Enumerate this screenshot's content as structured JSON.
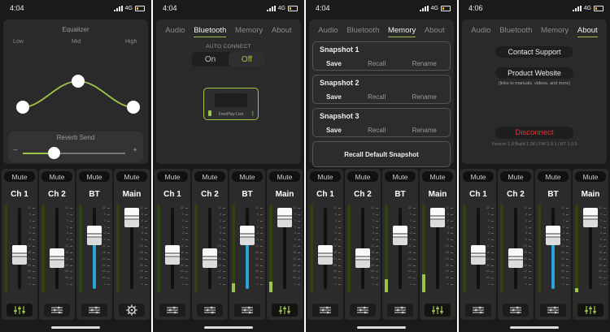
{
  "tab_labels": [
    "Audio",
    "Bluetooth",
    "Memory",
    "About"
  ],
  "screens": [
    {
      "time": "4:04",
      "network": "4G",
      "active_tab": null,
      "equalizer": {
        "title": "Equalizer",
        "low": "Low",
        "mid": "Mid",
        "high": "High",
        "curve": "bell"
      },
      "reverb": {
        "title": "Reverb Send",
        "minus": "−",
        "plus": "+",
        "level": 0.3
      },
      "channels": [
        {
          "mute": "Mute",
          "name": "Ch 1",
          "fader": 0.6,
          "meter": 0.0,
          "icon": "mixer-sliders-icon",
          "icon_active": true,
          "blue": 0
        },
        {
          "mute": "Mute",
          "name": "Ch 2",
          "fader": 0.65,
          "meter": 0.0,
          "icon": "sliders-icon",
          "icon_active": false,
          "blue": 0
        },
        {
          "mute": "Mute",
          "name": "BT",
          "fader": 0.3,
          "meter": 0.0,
          "icon": "sliders-icon",
          "icon_active": false,
          "blue": 0.55
        },
        {
          "mute": "Mute",
          "name": "Main",
          "fader": 0.03,
          "meter": 0.0,
          "icon": "gear-icon",
          "icon_active": false,
          "blue": 0
        }
      ]
    },
    {
      "time": "4:04",
      "network": "4G",
      "active_tab": "Bluetooth",
      "auto_connect": {
        "title": "AUTO CONNECT",
        "on": "On",
        "off": "Off",
        "selected": "Off"
      },
      "device": {
        "name": "FreePlay Live",
        "icon": "bluetooth-icon"
      },
      "channels": [
        {
          "mute": "Mute",
          "name": "Ch 1",
          "fader": 0.6,
          "meter": 0.0,
          "icon": "sliders-icon",
          "icon_active": false,
          "blue": 0
        },
        {
          "mute": "Mute",
          "name": "Ch 2",
          "fader": 0.65,
          "meter": 0.0,
          "icon": "sliders-icon",
          "icon_active": false,
          "blue": 0
        },
        {
          "mute": "Mute",
          "name": "BT",
          "fader": 0.3,
          "meter": 0.1,
          "icon": "sliders-icon",
          "icon_active": false,
          "blue": 0.55
        },
        {
          "mute": "Mute",
          "name": "Main",
          "fader": 0.03,
          "meter": 0.12,
          "icon": "mixer-sliders-icon",
          "icon_active": true,
          "blue": 0
        }
      ]
    },
    {
      "time": "4:04",
      "network": "4G",
      "active_tab": "Memory",
      "snapshots": [
        {
          "name": "Snapshot 1",
          "save": "Save",
          "recall": "Recall",
          "rename": "Rename"
        },
        {
          "name": "Snapshot 2",
          "save": "Save",
          "recall": "Recall",
          "rename": "Rename"
        },
        {
          "name": "Snapshot 3",
          "save": "Save",
          "recall": "Recall",
          "rename": "Rename"
        }
      ],
      "recall_default": "Recall Default Snapshot",
      "channels": [
        {
          "mute": "Mute",
          "name": "Ch 1",
          "fader": 0.6,
          "meter": 0.0,
          "icon": "sliders-icon",
          "icon_active": false,
          "blue": 0
        },
        {
          "mute": "Mute",
          "name": "Ch 2",
          "fader": 0.65,
          "meter": 0.0,
          "icon": "sliders-icon",
          "icon_active": false,
          "blue": 0
        },
        {
          "mute": "Mute",
          "name": "BT",
          "fader": 0.3,
          "meter": 0.15,
          "icon": "sliders-icon",
          "icon_active": false,
          "blue": 0
        },
        {
          "mute": "Mute",
          "name": "Main",
          "fader": 0.03,
          "meter": 0.2,
          "icon": "mixer-sliders-icon",
          "icon_active": true,
          "blue": 0
        }
      ]
    },
    {
      "time": "4:06",
      "network": "4G",
      "active_tab": "About",
      "contact": "Contact Support",
      "website": "Product Website",
      "links_note": "(links to manuals, videos, and more)",
      "disconnect": "Disconnect",
      "version": "Version 1.0 Build 1.28 | FW 1.0.1 | BT 1.0.5",
      "channels": [
        {
          "mute": "Mute",
          "name": "Ch 1",
          "fader": 0.6,
          "meter": 0.0,
          "icon": "sliders-icon",
          "icon_active": false,
          "blue": 0
        },
        {
          "mute": "Mute",
          "name": "Ch 2",
          "fader": 0.65,
          "meter": 0.0,
          "icon": "sliders-icon",
          "icon_active": false,
          "blue": 0
        },
        {
          "mute": "Mute",
          "name": "BT",
          "fader": 0.3,
          "meter": 0.0,
          "icon": "sliders-icon",
          "icon_active": false,
          "blue": 0.55
        },
        {
          "mute": "Mute",
          "name": "Main",
          "fader": 0.03,
          "meter": 0.05,
          "icon": "mixer-sliders-icon",
          "icon_active": true,
          "blue": 0
        }
      ]
    }
  ],
  "meter_scale": [
    "12",
    "6",
    "3",
    "0",
    "-3",
    "-6",
    "-12",
    "-18",
    "-24",
    "-30",
    "-40",
    "-60",
    "∞"
  ],
  "colors": {
    "accent": "#9cc44a",
    "bt_fill": "#2aa3d6",
    "disconnect": "#e03a2f",
    "bg": "#1a1a1a",
    "panel": "#2a2a2a"
  }
}
